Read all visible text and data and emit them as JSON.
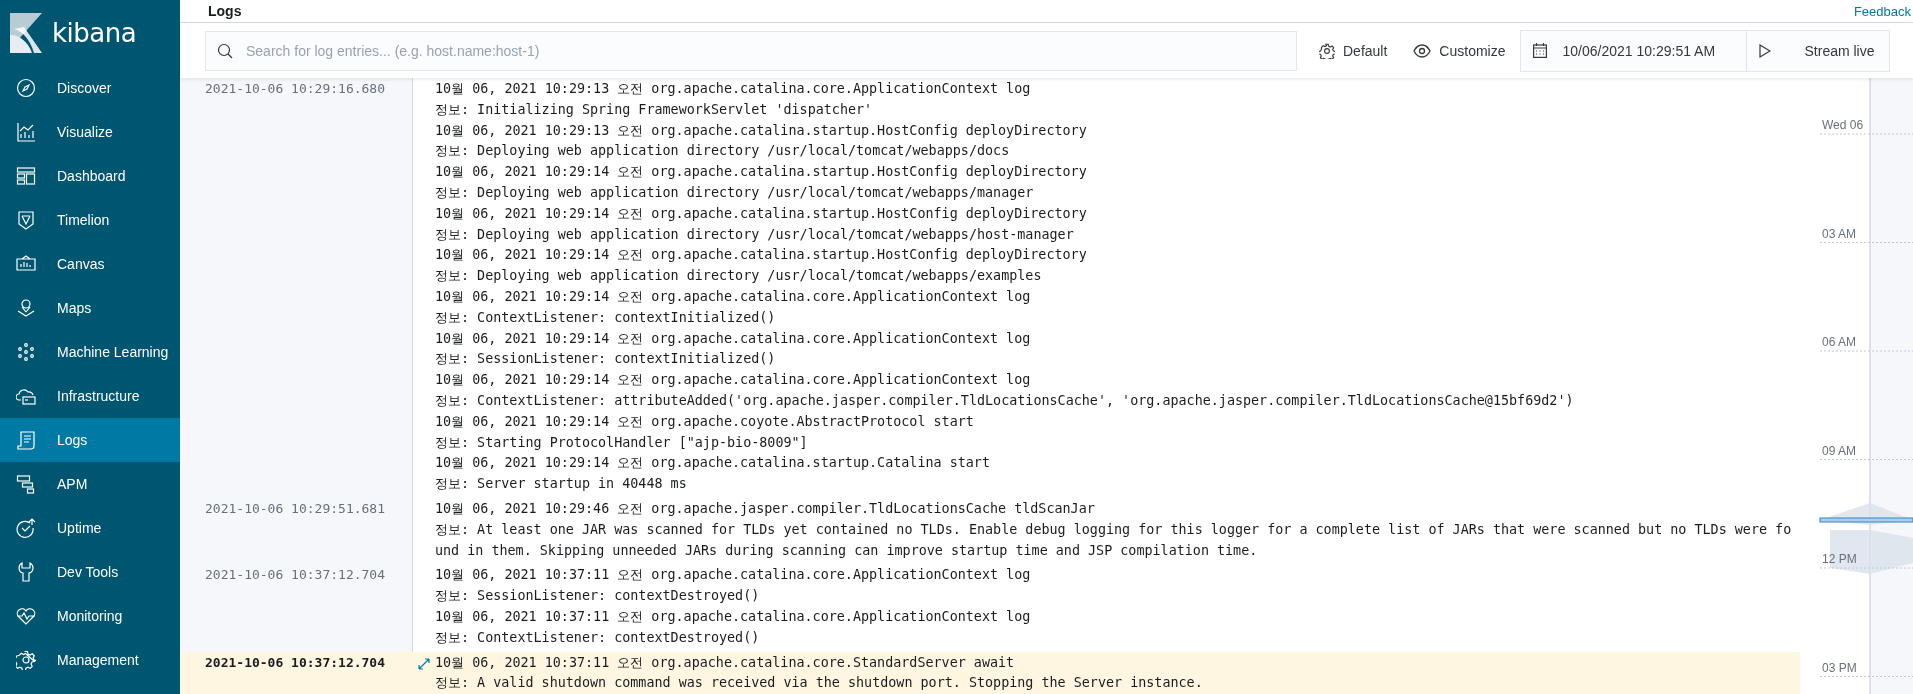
{
  "header": {
    "title": "Logs",
    "feedback_link": "Feedback"
  },
  "sidebar": {
    "logo": "kibana",
    "items": [
      {
        "label": "Discover",
        "selected": false
      },
      {
        "label": "Visualize",
        "selected": false
      },
      {
        "label": "Dashboard",
        "selected": false
      },
      {
        "label": "Timelion",
        "selected": false
      },
      {
        "label": "Canvas",
        "selected": false
      },
      {
        "label": "Maps",
        "selected": false
      },
      {
        "label": "Machine Learning",
        "selected": false
      },
      {
        "label": "Infrastructure",
        "selected": false
      },
      {
        "label": "Logs",
        "selected": true
      },
      {
        "label": "APM",
        "selected": false
      },
      {
        "label": "Uptime",
        "selected": false
      },
      {
        "label": "Dev Tools",
        "selected": false
      },
      {
        "label": "Monitoring",
        "selected": false
      },
      {
        "label": "Management",
        "selected": false
      }
    ]
  },
  "toolbar": {
    "search": {
      "placeholder": "Search for log entries... (e.g. host.name:host-1)"
    },
    "buttons": [
      "Default",
      "Customize"
    ],
    "date": "10/06/2021 10:29:51 AM",
    "stream_button": "Stream live"
  },
  "log": {
    "entries": [
      {
        "timestamp": "2021-10-06 10:29:16.680",
        "highlighted": false,
        "lines": [
          "10월 06, 2021 10:29:13 오전 org.apache.catalina.core.ApplicationContext log",
          "정보: Initializing Spring FrameworkServlet 'dispatcher'",
          "10월 06, 2021 10:29:13 오전 org.apache.catalina.startup.HostConfig deployDirectory",
          "정보: Deploying web application directory /usr/local/tomcat/webapps/docs",
          "10월 06, 2021 10:29:14 오전 org.apache.catalina.startup.HostConfig deployDirectory",
          "정보: Deploying web application directory /usr/local/tomcat/webapps/manager",
          "10월 06, 2021 10:29:14 오전 org.apache.catalina.startup.HostConfig deployDirectory",
          "정보: Deploying web application directory /usr/local/tomcat/webapps/host-manager",
          "10월 06, 2021 10:29:14 오전 org.apache.catalina.startup.HostConfig deployDirectory",
          "정보: Deploying web application directory /usr/local/tomcat/webapps/examples",
          "10월 06, 2021 10:29:14 오전 org.apache.catalina.core.ApplicationContext log",
          "정보: ContextListener: contextInitialized()",
          "10월 06, 2021 10:29:14 오전 org.apache.catalina.core.ApplicationContext log",
          "정보: SessionListener: contextInitialized()",
          "10월 06, 2021 10:29:14 오전 org.apache.catalina.core.ApplicationContext log",
          "정보: ContextListener: attributeAdded('org.apache.jasper.compiler.TldLocationsCache', 'org.apache.jasper.compiler.TldLocationsCache@15bf69d2')",
          "10월 06, 2021 10:29:14 오전 org.apache.coyote.AbstractProtocol start",
          "정보: Starting ProtocolHandler [\"ajp-bio-8009\"]",
          "10월 06, 2021 10:29:14 오전 org.apache.catalina.startup.Catalina start",
          "정보: Server startup in 40448 ms"
        ]
      },
      {
        "timestamp": "2021-10-06 10:29:51.681",
        "highlighted": false,
        "lines": [
          "10월 06, 2021 10:29:46 오전 org.apache.jasper.compiler.TldLocationsCache tldScanJar",
          "정보: At least one JAR was scanned for TLDs yet contained no TLDs. Enable debug logging for this logger for a complete list of JARs that were scanned but no TLDs were found in them. Skipping unneeded JARs during scanning can improve startup time and JSP compilation time."
        ]
      },
      {
        "timestamp": "2021-10-06 10:37:12.704",
        "highlighted": false,
        "lines": [
          "10월 06, 2021 10:37:11 오전 org.apache.catalina.core.ApplicationContext log",
          "정보: SessionListener: contextDestroyed()",
          "10월 06, 2021 10:37:11 오전 org.apache.catalina.core.ApplicationContext log",
          "정보: ContextListener: contextDestroyed()"
        ]
      },
      {
        "timestamp": "2021-10-06 10:37:12.704",
        "highlighted": true,
        "lines": [
          "10월 06, 2021 10:37:11 오전 org.apache.catalina.core.StandardServer await",
          "정보: A valid shutdown command was received via the shutdown port. Stopping the Server instance."
        ]
      }
    ]
  },
  "timeline": {
    "ticks": [
      "Wed 06",
      "03 AM",
      "06 AM",
      "09 AM",
      "12 PM",
      "03 PM"
    ]
  }
}
